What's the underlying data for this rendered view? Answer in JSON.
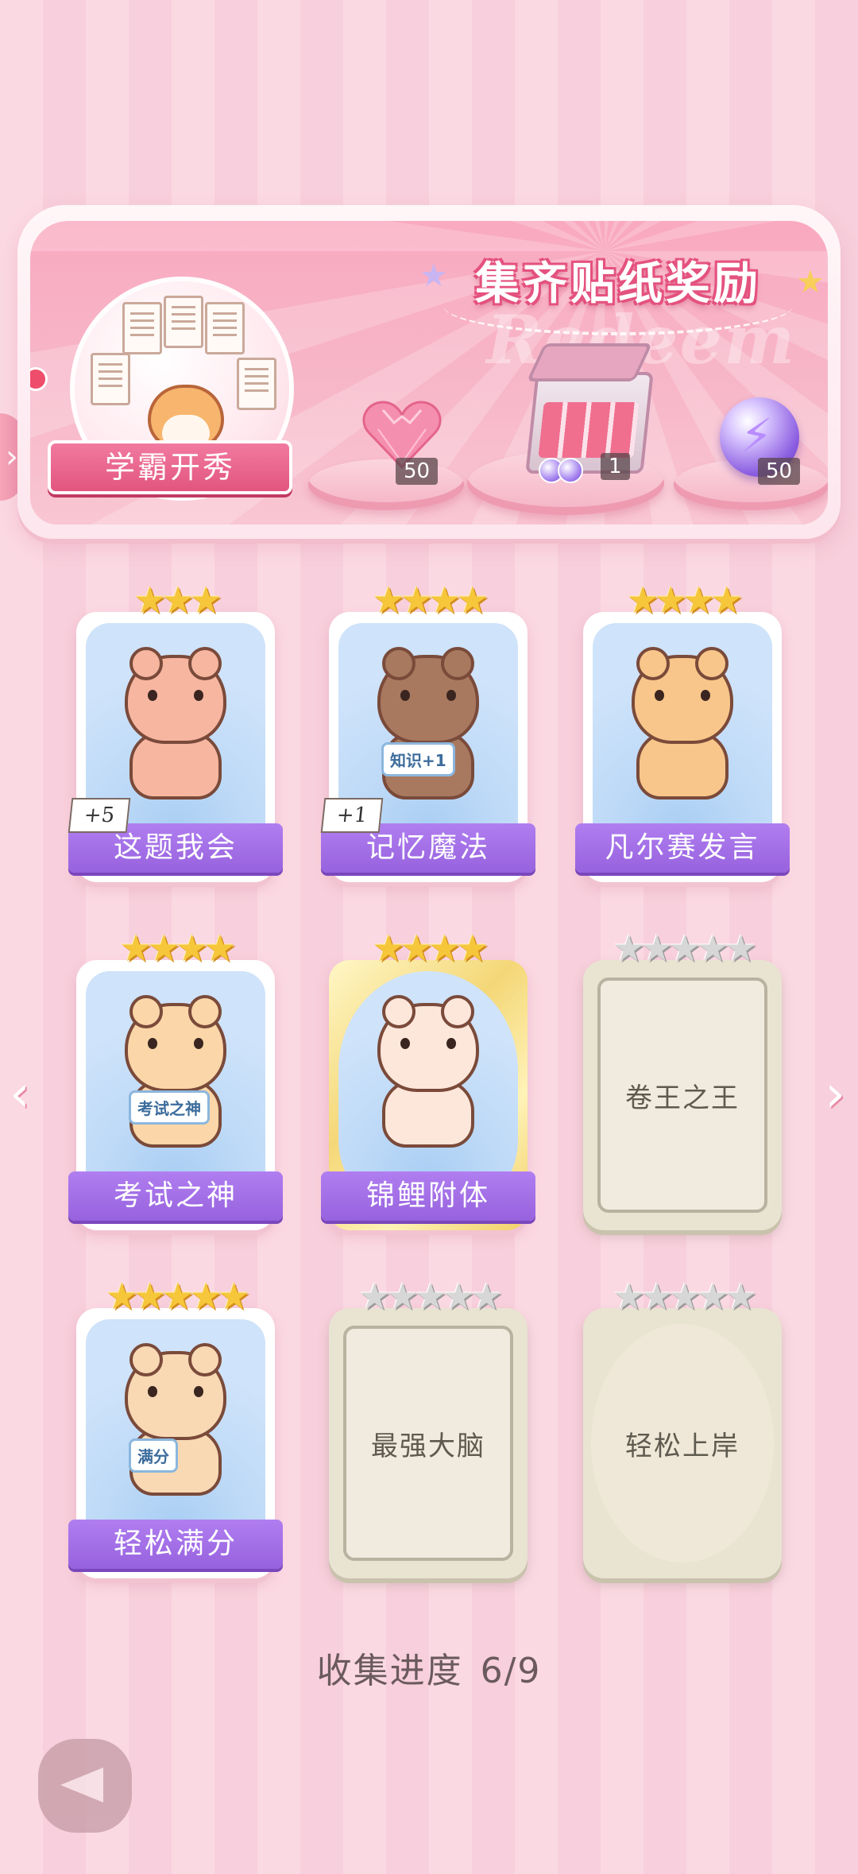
{
  "banner": {
    "title": "集齐贴纸奖励",
    "watermark": "Redeem",
    "achievement_label": "学霸开秀",
    "rewards": [
      {
        "icon": "heart-gem-icon",
        "count": "50"
      },
      {
        "icon": "gift-box-icon",
        "count": "1"
      },
      {
        "icon": "lightning-orb-icon",
        "count": "50"
      }
    ]
  },
  "cards": [
    {
      "name": "这题我会",
      "stars": 3,
      "state": "unlocked",
      "frame": "normal",
      "bonus": "+5",
      "critter": "bear"
    },
    {
      "name": "记忆魔法",
      "stars": 4,
      "state": "unlocked",
      "frame": "normal",
      "bonus": "+1",
      "critter": "otter-wizard",
      "art_text": "知识+1"
    },
    {
      "name": "凡尔赛发言",
      "stars": 4,
      "state": "unlocked",
      "frame": "normal",
      "bonus": "",
      "critter": "lion"
    },
    {
      "name": "考试之神",
      "stars": 4,
      "state": "unlocked",
      "frame": "normal",
      "bonus": "",
      "critter": "cat-angel",
      "art_text": "考试之神"
    },
    {
      "name": "锦鲤附体",
      "stars": 4,
      "state": "unlocked",
      "frame": "gold",
      "bonus": "",
      "critter": "bear-koi"
    },
    {
      "name": "卷王之王",
      "stars": 5,
      "state": "locked",
      "frame": "normal",
      "bonus": ""
    },
    {
      "name": "轻松满分",
      "stars": 5,
      "state": "unlocked",
      "frame": "normal",
      "bonus": "",
      "critter": "puppy",
      "art_text": "满分"
    },
    {
      "name": "最强大脑",
      "stars": 5,
      "state": "locked",
      "frame": "normal",
      "bonus": ""
    },
    {
      "name": "轻松上岸",
      "stars": 5,
      "state": "locked",
      "frame": "gold",
      "bonus": ""
    }
  ],
  "progress": {
    "label": "收集进度",
    "value": "6/9"
  },
  "nav": {
    "prev": "‹",
    "next": "›"
  },
  "colors": {
    "name_plate": "#9762de",
    "star_gold": "#f6c63b",
    "star_silver": "#d7d7d7",
    "banner_pink": "#f7b7c9"
  }
}
